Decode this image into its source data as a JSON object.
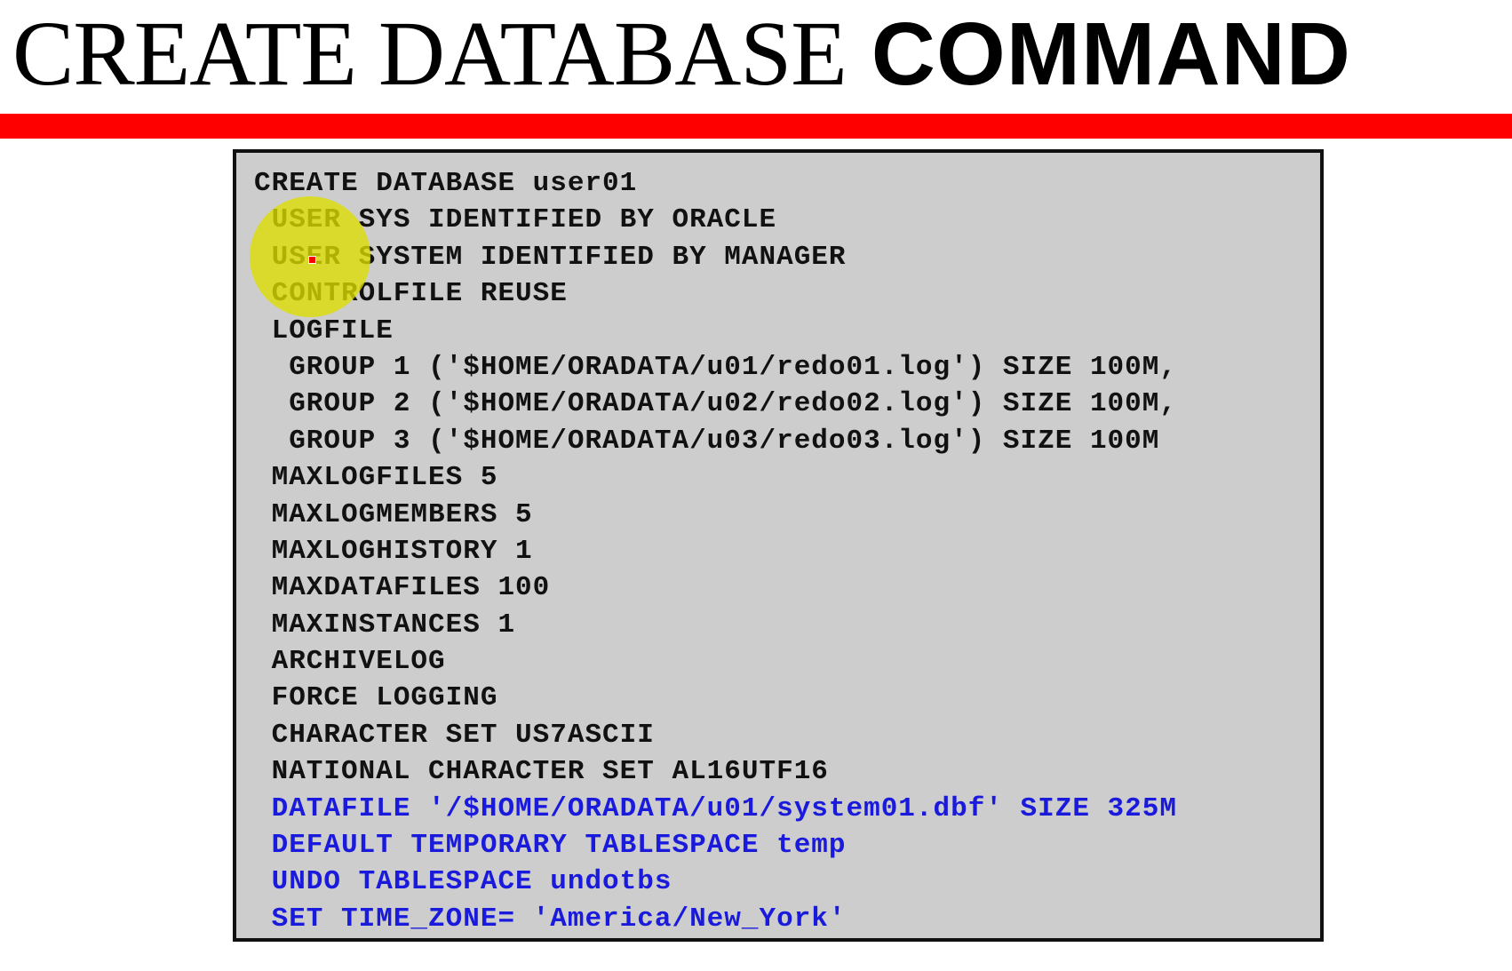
{
  "title": {
    "light": "CREATE DATABASE",
    "bold": "COMMAND"
  },
  "colors": {
    "accent_bar": "#ff0000",
    "code_background": "#cdcdcd",
    "code_text": "#111111",
    "code_highlight_text": "#1a1adc",
    "pointer_highlight": "#dede00"
  },
  "code": {
    "lines": [
      {
        "text": "CREATE DATABASE user01",
        "color": "black"
      },
      {
        "text": " USER SYS IDENTIFIED BY ORACLE",
        "color": "black"
      },
      {
        "text": " USER SYSTEM IDENTIFIED BY MANAGER",
        "color": "black"
      },
      {
        "text": " CONTROLFILE REUSE",
        "color": "black"
      },
      {
        "text": " LOGFILE",
        "color": "black"
      },
      {
        "text": "  GROUP 1 ('$HOME/ORADATA/u01/redo01.log') SIZE 100M,",
        "color": "black"
      },
      {
        "text": "  GROUP 2 ('$HOME/ORADATA/u02/redo02.log') SIZE 100M,",
        "color": "black"
      },
      {
        "text": "  GROUP 3 ('$HOME/ORADATA/u03/redo03.log') SIZE 100M",
        "color": "black"
      },
      {
        "text": " MAXLOGFILES 5",
        "color": "black"
      },
      {
        "text": " MAXLOGMEMBERS 5",
        "color": "black"
      },
      {
        "text": " MAXLOGHISTORY 1",
        "color": "black"
      },
      {
        "text": " MAXDATAFILES 100",
        "color": "black"
      },
      {
        "text": " MAXINSTANCES 1",
        "color": "black"
      },
      {
        "text": " ARCHIVELOG",
        "color": "black"
      },
      {
        "text": " FORCE LOGGING",
        "color": "black"
      },
      {
        "text": " CHARACTER SET US7ASCII",
        "color": "black"
      },
      {
        "text": " NATIONAL CHARACTER SET AL16UTF16",
        "color": "black"
      },
      {
        "text": " DATAFILE '/$HOME/ORADATA/u01/system01.dbf' SIZE 325M",
        "color": "blue"
      },
      {
        "text": " DEFAULT TEMPORARY TABLESPACE temp",
        "color": "blue"
      },
      {
        "text": " UNDO TABLESPACE undotbs",
        "color": "blue"
      },
      {
        "text": " SET TIME_ZONE= 'America/New_York'",
        "color": "blue"
      }
    ]
  }
}
